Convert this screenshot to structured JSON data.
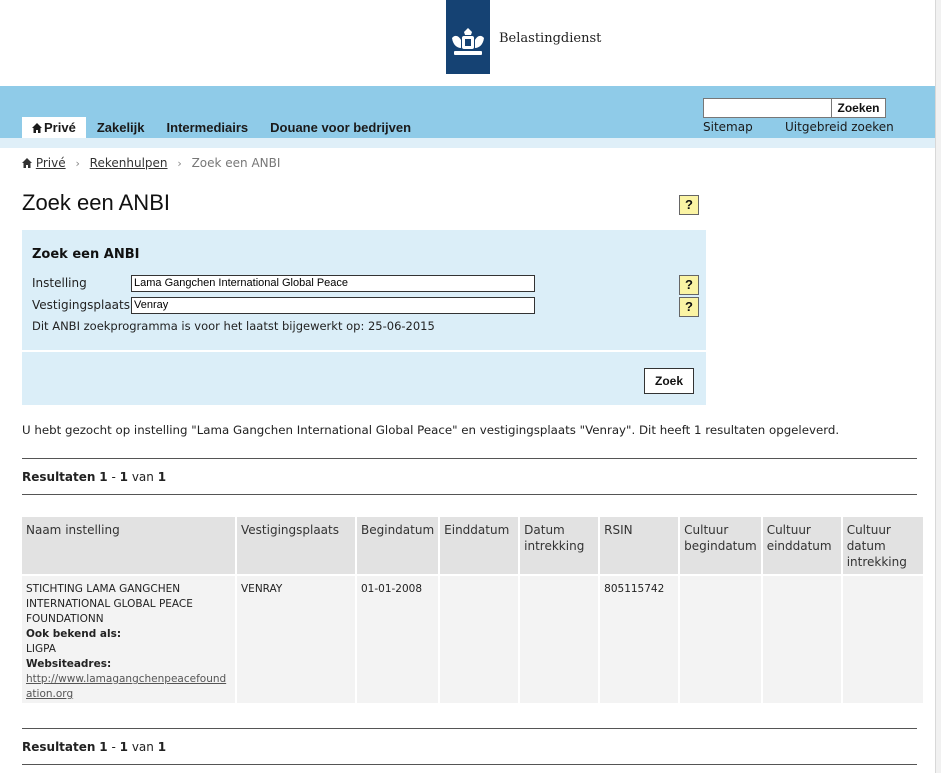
{
  "header": {
    "brand": "Belastingdienst"
  },
  "nav": {
    "items": [
      {
        "label": "Privé",
        "active": true
      },
      {
        "label": "Zakelijk"
      },
      {
        "label": "Intermediairs"
      },
      {
        "label": "Douane voor bedrijven"
      }
    ]
  },
  "search": {
    "button_label": "Zoeken",
    "value": ""
  },
  "utility_links": {
    "sitemap": "Sitemap",
    "advanced": "Uitgebreid zoeken"
  },
  "breadcrumb": {
    "home": "Privé",
    "parent": "Rekenhulpen",
    "current": "Zoek een ANBI",
    "separator": "›"
  },
  "page": {
    "title": "Zoek een ANBI",
    "help": "?"
  },
  "form": {
    "title": "Zoek een ANBI",
    "institution_label": "Instelling",
    "institution_value": "Lama Gangchen International Global Peace",
    "location_label": "Vestigingsplaats",
    "location_value": "Venray",
    "updated_text": "Dit ANBI zoekprogramma is voor het laatst bijgewerkt op: 25-06-2015",
    "submit_label": "Zoek"
  },
  "summary": "U hebt gezocht op instelling \"Lama Gangchen International Global Peace\" en vestigingsplaats \"Venray\". Dit heeft 1 resultaten opgeleverd.",
  "results_count": {
    "prefix": "Resultaten",
    "from": "1",
    "dash": "-",
    "to": "1",
    "of_word": "van",
    "total": "1"
  },
  "table": {
    "headers": [
      "Naam instelling",
      "Vestigingsplaats",
      "Begindatum",
      "Einddatum",
      "Datum intrekking",
      "RSIN",
      "Cultuur begindatum",
      "Cultuur einddatum",
      "Cultuur datum intrekking"
    ],
    "rows": [
      {
        "name": "STICHTING LAMA GANGCHEN INTERNATIONAL GLOBAL PEACE FOUNDATIONN",
        "aka_label": "Ook bekend als:",
        "aka_value": "LIGPA",
        "website_label": "Websiteadres:",
        "website": "http://www.lamagangchenpeacefoundation.org",
        "location": "VENRAY",
        "start_date": "01-01-2008",
        "end_date": "",
        "revoked_date": "",
        "rsin": "805115742",
        "culture_start": "",
        "culture_end": "",
        "culture_revoked": ""
      }
    ]
  },
  "colors": {
    "nav_band": "#8fcbe8",
    "form_panel": "#dbeef8",
    "logo_blue": "#154273",
    "help_yellow": "#fbf4a4"
  }
}
